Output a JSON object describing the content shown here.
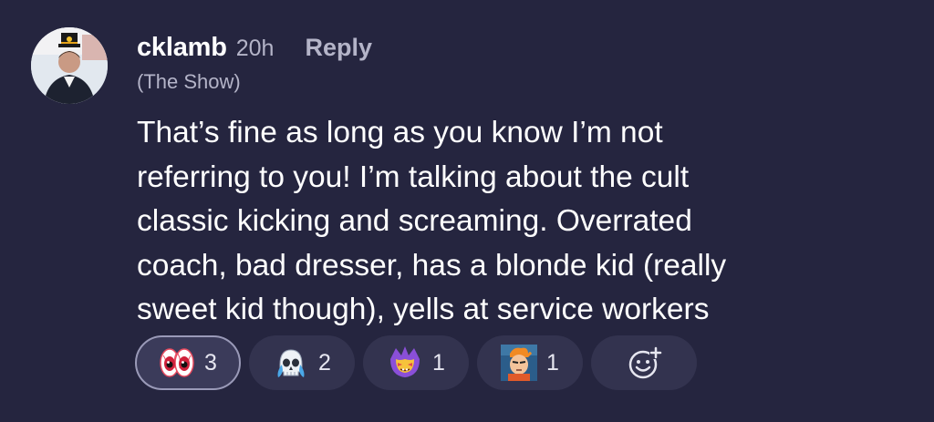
{
  "comment": {
    "username": "cklamb",
    "timestamp": "20h",
    "reply_label": "Reply",
    "subtitle": "(The Show)",
    "body_lines": [
      "That’s fine as long as you know I’m not",
      "referring to you! I’m talking about the cult",
      "classic kicking and screaming. Overrated",
      "coach, bad dresser, has a blonde kid (really",
      "sweet kid though), yells at service workers"
    ]
  },
  "reactions": [
    {
      "icon": "eyes-emoji-icon",
      "count": "3",
      "selected": true
    },
    {
      "icon": "skull-crying-emoji-icon",
      "count": "2",
      "selected": false
    },
    {
      "icon": "crowned-purple-face-emoji-icon",
      "count": "1",
      "selected": false
    },
    {
      "icon": "fry-squint-emoji-icon",
      "count": "1",
      "selected": false
    }
  ],
  "add_reaction_icon": "add-reaction-icon",
  "colors": {
    "background": "#25253f",
    "chip": "#33334f",
    "muted_text": "#b4b4c8"
  }
}
